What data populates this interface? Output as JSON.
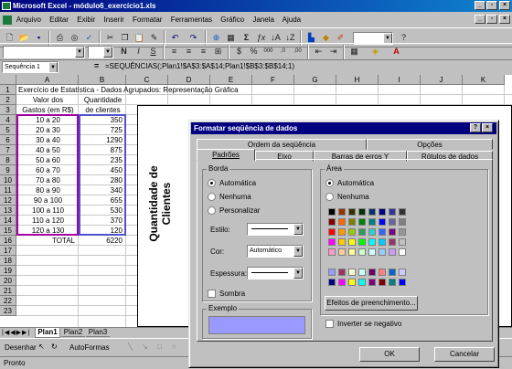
{
  "app": {
    "title": "Microsoft Excel - módulo6_exercício1.xls"
  },
  "menu": [
    "Arquivo",
    "Editar",
    "Exibir",
    "Inserir",
    "Formatar",
    "Ferramentas",
    "Gráfico",
    "Janela",
    "Ajuda"
  ],
  "formula_bar": {
    "name_box": "Sequência 1",
    "content": "=SEQUÊNCIAS(;Plan1!$A$3:$A$14;Plan1!$B$3:$B$14;1)"
  },
  "columns": [
    "A",
    "B",
    "C",
    "D",
    "E",
    "F",
    "G",
    "H",
    "I",
    "J",
    "K"
  ],
  "rows": [
    "1",
    "2",
    "3",
    "4",
    "5",
    "6",
    "7",
    "8",
    "9",
    "10",
    "11",
    "12",
    "13",
    "14",
    "15",
    "16",
    "17",
    "18",
    "19",
    "20",
    "21",
    "22",
    "23"
  ],
  "sheet": {
    "title": "Exercício de Estatística - Dados Agrupados: Representação Gráfica",
    "header_a1": "Valor dos",
    "header_a2": "Gastos (em R$)",
    "header_b1": "Quantidade",
    "header_b2": "de clientes",
    "data": [
      {
        "range": "10 a 20",
        "count": "350"
      },
      {
        "range": "20 a 30",
        "count": "725"
      },
      {
        "range": "30 a 40",
        "count": "1290"
      },
      {
        "range": "40 a 50",
        "count": "875"
      },
      {
        "range": "50 a 60",
        "count": "235"
      },
      {
        "range": "60 a 70",
        "count": "450"
      },
      {
        "range": "70 a 80",
        "count": "280"
      },
      {
        "range": "80 a 90",
        "count": "340"
      },
      {
        "range": "90 a 100",
        "count": "655"
      },
      {
        "range": "100 a 110",
        "count": "530"
      },
      {
        "range": "110 a 120",
        "count": "370"
      },
      {
        "range": "120 a 130",
        "count": "120"
      }
    ],
    "total_label": "TOTAL",
    "total_value": "6220"
  },
  "chart": {
    "axis_title_1": "Quantidade de",
    "axis_title_2": "Clientes"
  },
  "sheet_tabs": [
    "Plan1",
    "Plan2",
    "Plan3"
  ],
  "drawbar": {
    "draw": "Desenhar",
    "autoshapes": "AutoFormas"
  },
  "status": "Pronto",
  "dialog": {
    "title": "Formatar seqüência de dados",
    "tabs_back": [
      "Ordem da seqüência",
      "Opções"
    ],
    "tabs_front": [
      "Padrões",
      "Eixo",
      "Barras de erros Y",
      "Rótulos de dados"
    ],
    "border": {
      "label": "Borda",
      "options": [
        "Automática",
        "Nenhuma",
        "Personalizar"
      ],
      "style_label": "Estilo:",
      "color_label": "Cor:",
      "color_value": "Automático",
      "weight_label": "Espessura:",
      "shadow_label": "Sombra"
    },
    "area": {
      "label": "Área",
      "options": [
        "Automática",
        "Nenhuma"
      ],
      "fill_effects": "Efeitos de preenchimento...",
      "invert": "Inverter se negativo"
    },
    "sample_label": "Exemplo",
    "sample_color": "#9999ff",
    "ok": "OK",
    "cancel": "Cancelar"
  }
}
